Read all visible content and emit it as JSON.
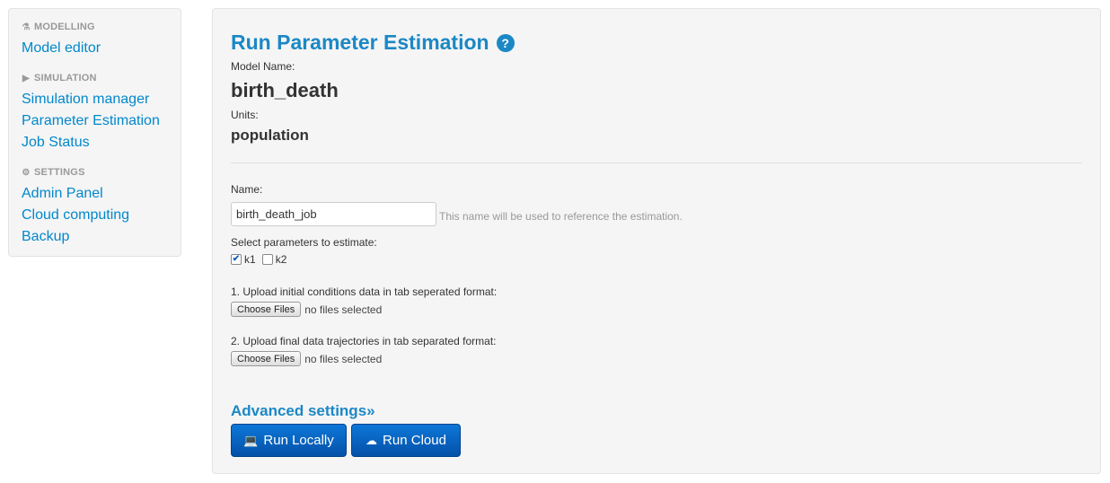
{
  "sidebar": {
    "sections": [
      {
        "header": "MODELLING",
        "icon": "flask-icon",
        "items": [
          "Model editor"
        ]
      },
      {
        "header": "SIMULATION",
        "icon": "play-icon",
        "items": [
          "Simulation manager",
          "Parameter Estimation",
          "Job Status"
        ]
      },
      {
        "header": "SETTINGS",
        "icon": "gear-icon",
        "items": [
          "Admin Panel",
          "Cloud computing",
          "Backup"
        ]
      }
    ]
  },
  "main": {
    "title": "Run Parameter Estimation",
    "help_glyph": "?",
    "model_name_label": "Model Name:",
    "model_name": "birth_death",
    "units_label": "Units:",
    "units": "population",
    "name_label": "Name:",
    "name_value": "birth_death_job",
    "name_help": "This name will be used to reference the estimation.",
    "params_label": "Select parameters to estimate:",
    "params": [
      {
        "label": "k1",
        "checked": true
      },
      {
        "label": "k2",
        "checked": false
      }
    ],
    "upload_initial_label": "1. Upload initial conditions data in tab seperated format:",
    "upload_final_label": "2. Upload final data trajectories in tab separated format:",
    "choose_files_label": "Choose Files",
    "no_files_text": "no files selected",
    "advanced_label": "Advanced settings»",
    "run_locally_label": "Run Locally",
    "run_cloud_label": "Run Cloud"
  },
  "colors": {
    "link": "#0088cc",
    "title": "#1b88c5",
    "button": "#0a66c2"
  }
}
